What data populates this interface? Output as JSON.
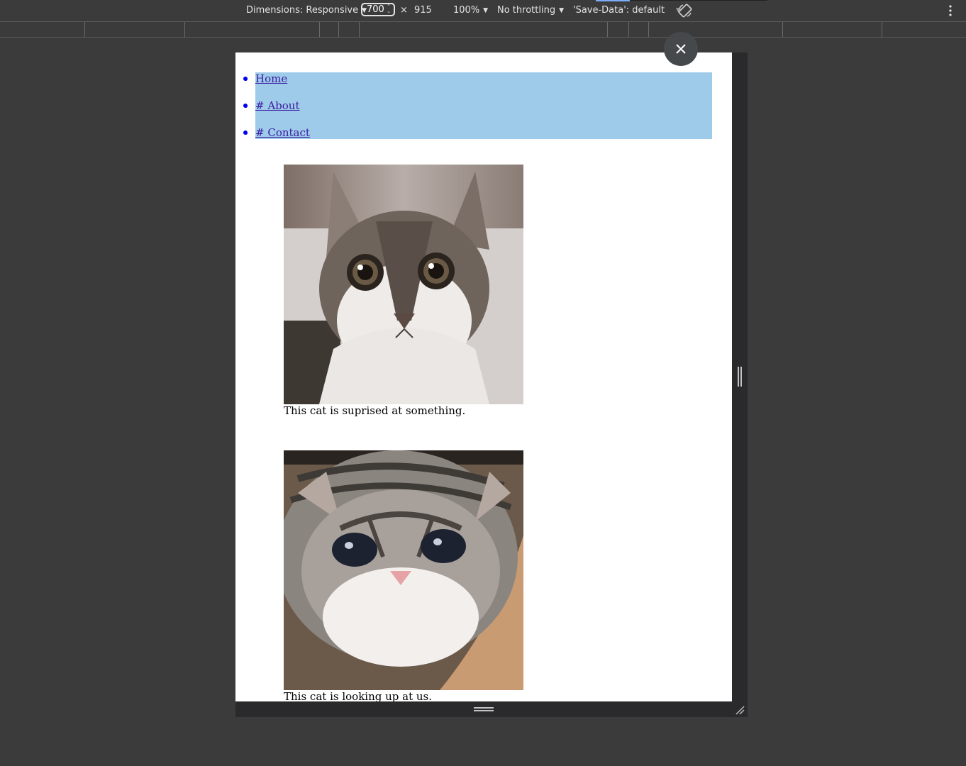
{
  "toolbar": {
    "dimensions_label": "Dimensions: Responsive",
    "width_value": "700",
    "times_symbol": "×",
    "height_value": "915",
    "zoom_label": "100%",
    "throttling_label": "No throttling",
    "save_data_label": "'Save-Data': default"
  },
  "close_symbol": "✕",
  "nav": {
    "items": [
      {
        "label": "Home"
      },
      {
        "label": "# About"
      },
      {
        "label": "# Contact"
      }
    ]
  },
  "figures": [
    {
      "caption": "This cat is suprised at something."
    },
    {
      "caption": "This cat is looking up at us."
    }
  ],
  "icons": {
    "rotate": "rotate-icon",
    "more": "kebab-menu-icon",
    "close": "close-icon",
    "resize": "resize-corner-icon"
  }
}
